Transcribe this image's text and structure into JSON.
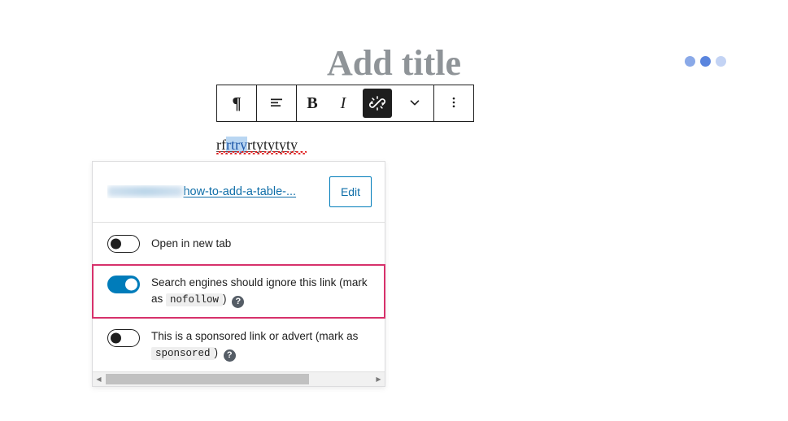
{
  "editor": {
    "title_placeholder": "Add title",
    "paragraph": {
      "before": "rf",
      "selected": "rtry",
      "after": "rtytytyty"
    }
  },
  "loading_indicator": {
    "dot1_color": "#8aa9e8",
    "dot2_color": "#5a85de",
    "dot3_color": "#c3d3f4"
  },
  "toolbar": {
    "paragraph_label": "¶",
    "align_label": "align-left",
    "bold_label": "B",
    "italic_label": "I",
    "link_label": "unlink",
    "chevron_label": "⌄",
    "more_label": "⋮"
  },
  "link_popover": {
    "url_redacted": "xxxxxxxx.com/",
    "url_visible": "how-to-add-a-table-...",
    "edit_label": "Edit",
    "settings": [
      {
        "name": "open-in-new-tab",
        "label_text": "Open in new tab",
        "state": "off",
        "has_code": false,
        "has_help": false,
        "highlighted": false
      },
      {
        "name": "nofollow",
        "label_prefix": "Search engines should ignore this link (mark as",
        "code": "nofollow",
        "label_suffix": ")",
        "state": "on",
        "has_code": true,
        "has_help": true,
        "help_label": "?",
        "highlighted": true,
        "highlight_color": "#d7316b"
      },
      {
        "name": "sponsored",
        "label_prefix": "This is a sponsored link or advert (mark as",
        "code": "sponsored",
        "label_suffix": ")",
        "state": "off",
        "has_code": true,
        "has_help": true,
        "help_label": "?",
        "highlighted": false
      }
    ],
    "scrollbar": {
      "left_arrow": "◀",
      "right_arrow": "▶",
      "thumb_pct": "76%"
    }
  }
}
